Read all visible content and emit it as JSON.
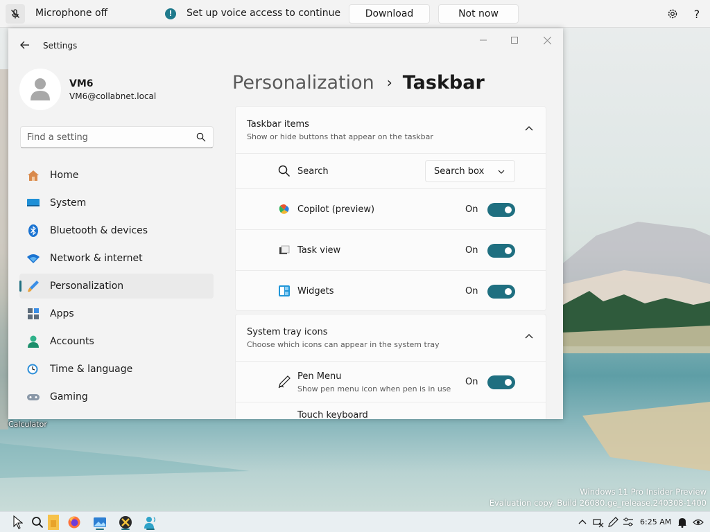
{
  "voice_bar": {
    "mic_status": "Microphone off",
    "message": "Set up voice access to continue",
    "download_label": "Download",
    "not_now_label": "Not now",
    "icons": [
      "mic-off-icon",
      "info-icon",
      "gear-icon",
      "help-icon"
    ]
  },
  "window": {
    "title": "Settings",
    "user": {
      "name": "VM6",
      "email": "VM6@collabnet.local"
    },
    "search": {
      "placeholder": "Find a setting"
    },
    "nav": [
      {
        "label": "Home",
        "icon": "home-icon"
      },
      {
        "label": "System",
        "icon": "system-icon"
      },
      {
        "label": "Bluetooth & devices",
        "icon": "bluetooth-icon"
      },
      {
        "label": "Network & internet",
        "icon": "wifi-icon"
      },
      {
        "label": "Personalization",
        "icon": "brush-icon",
        "active": true
      },
      {
        "label": "Apps",
        "icon": "apps-icon"
      },
      {
        "label": "Accounts",
        "icon": "accounts-icon"
      },
      {
        "label": "Time & language",
        "icon": "clock-icon"
      },
      {
        "label": "Gaming",
        "icon": "gamepad-icon"
      }
    ],
    "breadcrumb": {
      "parent": "Personalization",
      "separator": "›",
      "current": "Taskbar"
    },
    "taskbar_items": {
      "title": "Taskbar items",
      "subtitle": "Show or hide buttons that appear on the taskbar",
      "search": {
        "label": "Search",
        "value": "Search box"
      },
      "copilot": {
        "label": "Copilot (preview)",
        "state": "On"
      },
      "task_view": {
        "label": "Task view",
        "state": "On"
      },
      "widgets": {
        "label": "Widgets",
        "state": "On"
      }
    },
    "system_tray": {
      "title": "System tray icons",
      "subtitle": "Choose which icons can appear in the system tray",
      "pen_menu": {
        "label": "Pen Menu",
        "sub": "Show pen menu icon when pen is in use",
        "state": "On"
      },
      "touch_keyboard": {
        "label": "Touch keyboard"
      }
    },
    "accent_color": "#1f6f80"
  },
  "desktop": {
    "icon_label": "Calculator",
    "watermark_line1": "Windows 11 Pro Insider Preview",
    "watermark_line2": "Evaluation copy. Build 26080.ge_release.240308-1400"
  },
  "taskbar": {
    "clock": "6:25 AM",
    "apps": [
      "search-icon",
      "file-explorer-icon",
      "firefox-icon",
      "photos-icon",
      "xming-icon",
      "voice-access-icon"
    ]
  }
}
